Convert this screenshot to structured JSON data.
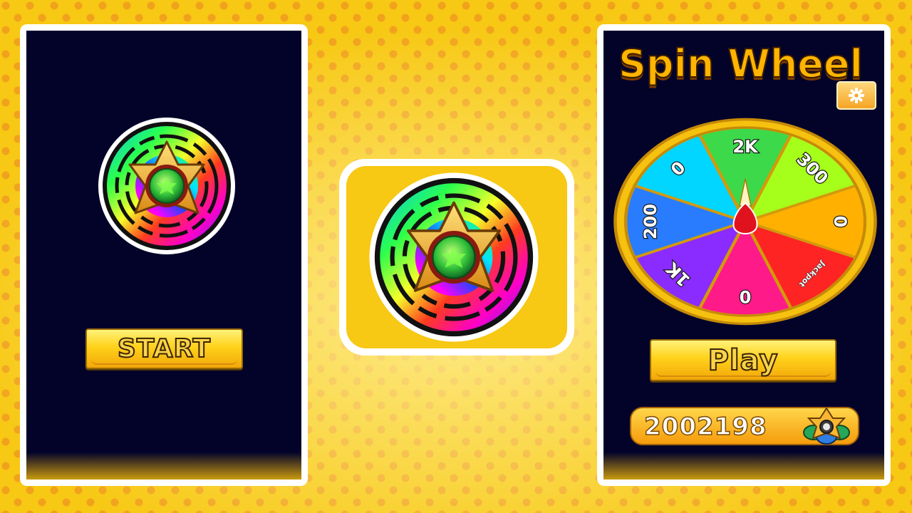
{
  "colors": {
    "background": "#f7c814",
    "background_dots": "#f1a21c",
    "phone_screen": "#03032a",
    "button_gold": "#ffd21a",
    "title_orange": "#ffb400"
  },
  "left_screen": {
    "logo_icon": "star-gem-emblem-icon",
    "start_label": "START"
  },
  "center": {
    "logo_icon": "star-gem-emblem-icon"
  },
  "right_screen": {
    "title": "Spin Wheel",
    "settings_icon": "gear-icon",
    "wheel_segments": [
      "2K",
      "300",
      "0",
      "Jackpot",
      "0",
      "1K",
      "200",
      "0"
    ],
    "play_label": "Play",
    "coin_count": "2002198",
    "coin_icon": "star-badge-icon"
  }
}
